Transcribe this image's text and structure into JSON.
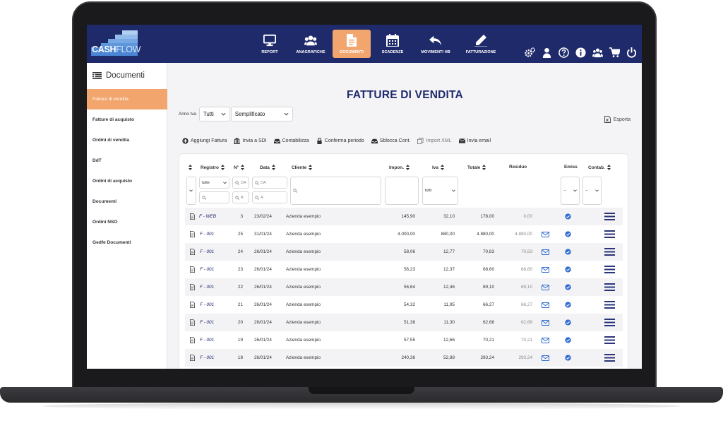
{
  "app": {
    "logo": {
      "part1": "CASH",
      "part2": "FLOW"
    },
    "brand_color": "#1f2a6b",
    "accent_color": "#f2a56c"
  },
  "nav": [
    {
      "label": "REPORT",
      "icon": "monitor-icon",
      "active": false
    },
    {
      "label": "ANAGRAFICHE",
      "icon": "users-icon",
      "active": false
    },
    {
      "label": "DOCUMENTI",
      "icon": "document-icon",
      "active": true
    },
    {
      "label": "SCADENZE",
      "icon": "calendar-icon",
      "active": false
    },
    {
      "label": "MOVIMENTI HB",
      "icon": "reply-all-icon",
      "active": false
    },
    {
      "label": "FATTURAZIONE",
      "icon": "pencil-icon",
      "active": false
    }
  ],
  "toolbar_icons": [
    "gears-icon",
    "user-icon",
    "help-icon",
    "info-icon",
    "team-icon",
    "cart-icon",
    "power-icon"
  ],
  "sidebar": {
    "title": "Documenti",
    "items": [
      {
        "label": "Fatture di vendita",
        "active": true
      },
      {
        "label": "Fatture di acquisto",
        "active": false
      },
      {
        "label": "Ordini di vendita",
        "active": false
      },
      {
        "label": "DdT",
        "active": false
      },
      {
        "label": "Ordini di acquisto",
        "active": false
      },
      {
        "label": "Documenti",
        "active": false
      },
      {
        "label": "Ordini NSO",
        "active": false
      },
      {
        "label": "Gedfe Documenti",
        "active": false
      }
    ]
  },
  "main": {
    "title": "FATTURE DI VENDITA",
    "anno_iva_label": "Anno Iva",
    "anno_iva_value": "Tutti",
    "view_value": "Semplificato",
    "export_label": "Esporta",
    "actions": [
      {
        "label": "Aggiungi Fattura",
        "icon": "plus-circle-icon",
        "enabled": true
      },
      {
        "label": "Invia a SDI",
        "icon": "bank-icon",
        "enabled": true
      },
      {
        "label": "Contabilizza",
        "icon": "inbox-icon",
        "enabled": true
      },
      {
        "label": "Conferma periodo",
        "icon": "lock-icon",
        "enabled": true
      },
      {
        "label": "Sblocca Cont.",
        "icon": "inbox-icon",
        "enabled": true
      },
      {
        "label": "Import XML",
        "icon": "copy-icon",
        "enabled": false
      },
      {
        "label": "Invia email",
        "icon": "envelope-icon",
        "enabled": true
      }
    ]
  },
  "table": {
    "headers": {
      "registro": "Registro",
      "numero": "N°",
      "data": "Data",
      "cliente": "Cliente",
      "imponibile": "Impon.",
      "iva": "Iva",
      "totale": "Totale",
      "residuo": "Residuo",
      "emiss": "Emiss",
      "contab": "Contab."
    },
    "filters": {
      "registro": "tutte",
      "numero_da": "DA",
      "numero_a": "A",
      "data_da": "DA",
      "data_a": "A",
      "iva": "tutti",
      "emiss": "--",
      "contab": "--"
    },
    "rows": [
      {
        "registro": "F - WEB",
        "numero": "3",
        "data": "23/02/24",
        "cliente": "Azienda esempio",
        "imponibile": "145,90",
        "iva": "32,10",
        "totale": "178,00",
        "residuo": "0,00",
        "email": false
      },
      {
        "registro": "F - 001",
        "numero": "25",
        "data": "31/01/24",
        "cliente": "Azienda esempio",
        "imponibile": "4.000,00",
        "iva": "880,00",
        "totale": "4.880,00",
        "residuo": "4.880,00",
        "email": true
      },
      {
        "registro": "F - 001",
        "numero": "24",
        "data": "26/01/24",
        "cliente": "Azienda esempio",
        "imponibile": "58,06",
        "iva": "12,77",
        "totale": "70,83",
        "residuo": "70,83",
        "email": true
      },
      {
        "registro": "F - 001",
        "numero": "23",
        "data": "26/01/24",
        "cliente": "Azienda esempio",
        "imponibile": "56,23",
        "iva": "12,37",
        "totale": "68,60",
        "residuo": "68,60",
        "email": true
      },
      {
        "registro": "F - 001",
        "numero": "22",
        "data": "26/01/24",
        "cliente": "Azienda esempio",
        "imponibile": "56,64",
        "iva": "12,46",
        "totale": "69,10",
        "residuo": "69,10",
        "email": true
      },
      {
        "registro": "F - 001",
        "numero": "21",
        "data": "26/01/24",
        "cliente": "Azienda esempio",
        "imponibile": "54,32",
        "iva": "11,95",
        "totale": "66,27",
        "residuo": "66,27",
        "email": true
      },
      {
        "registro": "F - 001",
        "numero": "20",
        "data": "26/01/24",
        "cliente": "Azienda esempio",
        "imponibile": "51,38",
        "iva": "11,30",
        "totale": "62,68",
        "residuo": "62,68",
        "email": true
      },
      {
        "registro": "F - 001",
        "numero": "19",
        "data": "26/01/24",
        "cliente": "Azienda esempio",
        "imponibile": "57,55",
        "iva": "12,66",
        "totale": "70,21",
        "residuo": "70,21",
        "email": true
      },
      {
        "registro": "F - 001",
        "numero": "18",
        "data": "26/01/24",
        "cliente": "Azienda esempio",
        "imponibile": "240,36",
        "iva": "52,88",
        "totale": "293,24",
        "residuo": "293,24",
        "email": true
      }
    ]
  }
}
